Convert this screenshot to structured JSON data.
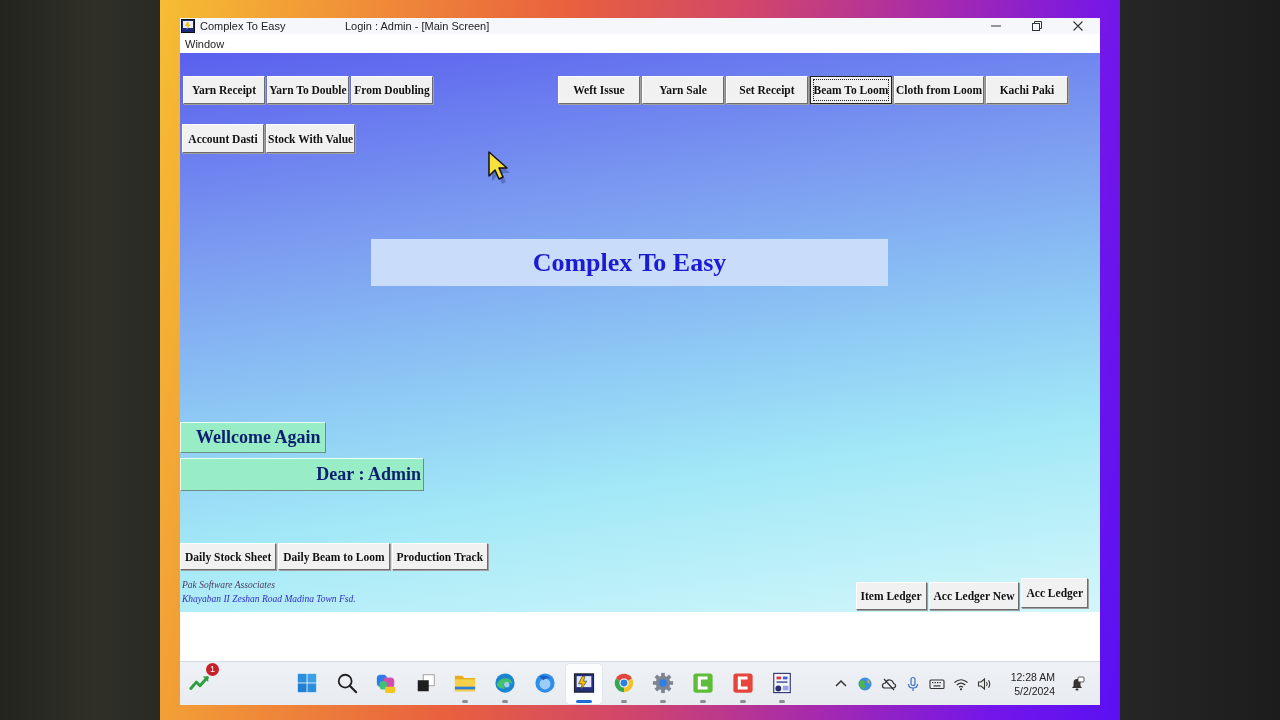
{
  "window": {
    "title": "Complex To Easy",
    "caption": "Login : Admin - [Main Screen]",
    "menu": [
      "Window"
    ]
  },
  "toolbar_left": [
    {
      "label": "Yarn Receipt",
      "focused": false
    },
    {
      "label": "Yarn To Double",
      "focused": false
    },
    {
      "label": "From Doubling",
      "focused": false
    }
  ],
  "toolbar_right": [
    {
      "label": "Weft Issue",
      "focused": false
    },
    {
      "label": "Yarn Sale",
      "focused": false
    },
    {
      "label": "Set Receipt",
      "focused": false
    },
    {
      "label": "Beam To Loom",
      "focused": true
    },
    {
      "label": "Cloth from Loom",
      "focused": false
    },
    {
      "label": "Kachi Paki",
      "focused": false
    }
  ],
  "toolbar_second_row": [
    {
      "label": "Account Dasti",
      "focused": false
    },
    {
      "label": "Stock With Value",
      "focused": false
    }
  ],
  "banner": {
    "title": "Complex To Easy"
  },
  "welcome": {
    "heading": "Wellcome Again",
    "greeting": "Dear : Admin"
  },
  "report_buttons": [
    {
      "label": "Daily Stock Sheet",
      "focused": false
    },
    {
      "label": "Daily Beam to Loom",
      "focused": false
    },
    {
      "label": "Production Track",
      "focused": false
    }
  ],
  "footer": {
    "company": "Pak Software Associates",
    "address": "Khayaban II Zeshan Road Madina Town Fsd."
  },
  "ledger_buttons": [
    {
      "label": "Item Ledger",
      "focused": false
    },
    {
      "label": "Acc Ledger New",
      "focused": false
    },
    {
      "label": "Acc Ledger",
      "focused": false
    }
  ],
  "taskbar": {
    "widget_badge": "1",
    "apps": [
      {
        "kind": "start",
        "running": false,
        "active": false
      },
      {
        "kind": "search",
        "running": false,
        "active": false
      },
      {
        "kind": "assistant",
        "running": false,
        "active": false
      },
      {
        "kind": "taskview",
        "running": false,
        "active": false
      },
      {
        "kind": "folder",
        "running": true,
        "active": false
      },
      {
        "kind": "wave",
        "running": true,
        "active": false
      },
      {
        "kind": "fox",
        "running": false,
        "active": false
      },
      {
        "kind": "app",
        "running": true,
        "active": true
      },
      {
        "kind": "ring",
        "running": true,
        "active": false
      },
      {
        "kind": "settings",
        "running": true,
        "active": false
      },
      {
        "kind": "recorder",
        "running": true,
        "active": false
      },
      {
        "kind": "editor",
        "running": true,
        "active": false
      },
      {
        "kind": "report",
        "running": true,
        "active": false
      }
    ],
    "clock": {
      "time": "12:28 AM",
      "date": "5/2/2024"
    }
  }
}
